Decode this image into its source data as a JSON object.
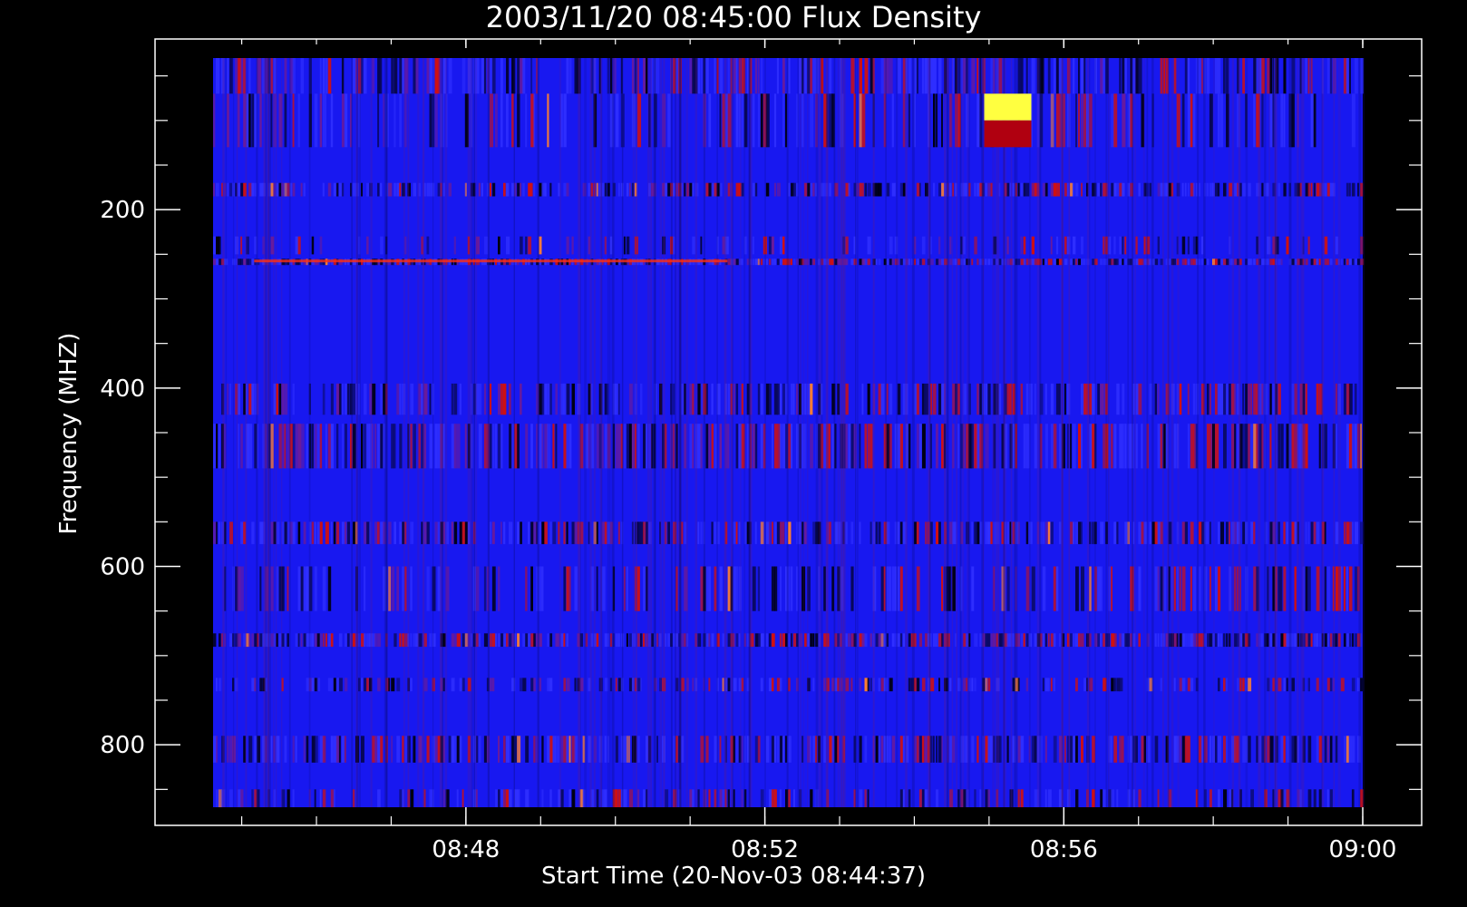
{
  "chart_data": {
    "type": "heatmap",
    "title": "2003/11/20 08:45:00 Flux Density",
    "xlabel": "Start Time (20-Nov-03 08:44:37)",
    "ylabel": "Frequency (MHZ)",
    "x_range_minutes": [
      "08:44:37",
      "09:00:00"
    ],
    "y_range": [
      30,
      870
    ],
    "y_reversed": true,
    "x_ticks": [
      "08:48",
      "08:52",
      "08:56",
      "09:00"
    ],
    "y_ticks": [
      200,
      400,
      600,
      800
    ],
    "colormap": {
      "low": "#000020",
      "mid": "#1010ff",
      "high": "#ff2000",
      "max": "#ffff40"
    },
    "features": [
      {
        "label": "yellow burst",
        "time": "08:55:15",
        "freq_range": [
          70,
          100
        ],
        "color": "#ffff40"
      },
      {
        "label": "red burst",
        "time": "08:55:15",
        "freq_range": [
          100,
          130
        ],
        "color": "#b00010"
      }
    ],
    "grid": false,
    "background": "#000000",
    "foreground": "#ffffff"
  }
}
